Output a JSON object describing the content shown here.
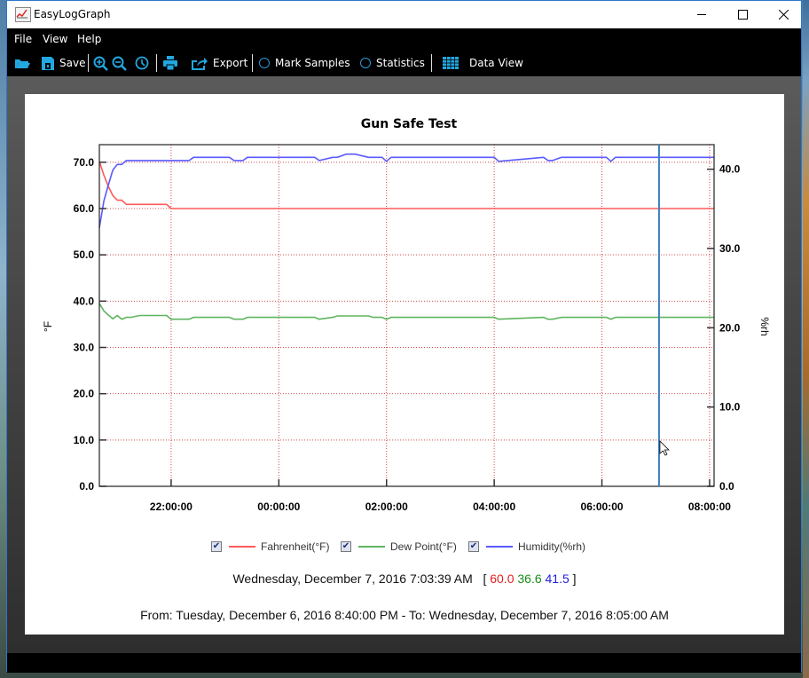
{
  "window": {
    "title": "EasyLogGraph",
    "minimize_icon": "minimize-icon",
    "maximize_icon": "maximize-icon",
    "close_icon": "close-icon"
  },
  "menu": {
    "items": [
      "File",
      "View",
      "Help"
    ]
  },
  "toolbar": {
    "open_icon": "folder-open-icon",
    "save_label": "Save",
    "zoom_in_icon": "zoom-in-icon",
    "zoom_out_icon": "zoom-out-icon",
    "clock_icon": "clock-icon",
    "print_icon": "printer-icon",
    "export_label": "Export",
    "mark_samples_label": "Mark Samples",
    "statistics_label": "Statistics",
    "data_view_label": "Data View"
  },
  "colors": {
    "fahrenheit": "#ff5a5a",
    "dew_point": "#5fb55f",
    "humidity": "#5a5aff",
    "cursor": "#3a7fbf",
    "grid": "#c81e1e",
    "accent": "#22a7e0"
  },
  "chart_data": {
    "type": "line",
    "title": "Gun Safe Test",
    "xlabel": "",
    "ylabel": "°F",
    "y2label": "%rh",
    "x_range": [
      "20:40:00",
      "08:05:00"
    ],
    "x_range_minutes": [
      0,
      685
    ],
    "xticks": [
      "22:00:00",
      "00:00:00",
      "02:00:00",
      "04:00:00",
      "06:00:00",
      "08:00:00"
    ],
    "xticks_minutes": [
      80,
      200,
      320,
      440,
      560,
      680
    ],
    "ylim": [
      0,
      73.8
    ],
    "yticks": [
      "0.0",
      "10.0",
      "20.0",
      "30.0",
      "40.0",
      "50.0",
      "60.0",
      "70.0"
    ],
    "y2lim": [
      0,
      43.1
    ],
    "y2ticks": [
      "0.0",
      "10.0",
      "20.0",
      "30.0",
      "40.0"
    ],
    "grid": true,
    "legend_placement": "bottom",
    "series": [
      {
        "name": "Fahrenheit(°F)",
        "axis": "left",
        "color": "#ff5a5a",
        "x": [
          0,
          5,
          10,
          15,
          20,
          25,
          30,
          35,
          40,
          75,
          80,
          200,
          320,
          440,
          560,
          685
        ],
        "y": [
          70.2,
          67.2,
          64.8,
          62.8,
          61.8,
          61.8,
          60.9,
          60.9,
          60.9,
          60.9,
          60.0,
          60.0,
          60.0,
          60.0,
          60.0,
          60.0
        ]
      },
      {
        "name": "Dew Point(°F)",
        "axis": "left",
        "color": "#5fb55f",
        "x": [
          0,
          5,
          10,
          15,
          20,
          25,
          30,
          35,
          45,
          75,
          80,
          100,
          105,
          145,
          150,
          160,
          165,
          200,
          240,
          245,
          260,
          265,
          300,
          305,
          315,
          320,
          325,
          440,
          445,
          495,
          500,
          505,
          515,
          565,
          570,
          575,
          585,
          685
        ],
        "y": [
          39.5,
          37.9,
          37.0,
          36.2,
          36.9,
          36.1,
          36.5,
          36.5,
          36.9,
          36.9,
          36.1,
          36.1,
          36.5,
          36.5,
          36.1,
          36.1,
          36.5,
          36.5,
          36.5,
          36.1,
          36.5,
          36.8,
          36.8,
          36.5,
          36.5,
          36.1,
          36.5,
          36.5,
          36.1,
          36.5,
          36.1,
          36.1,
          36.5,
          36.5,
          36.1,
          36.5,
          36.5,
          36.5
        ]
      },
      {
        "name": "Humidity(%rh)",
        "axis": "right",
        "color": "#5a5aff",
        "x": [
          0,
          5,
          10,
          15,
          20,
          25,
          30,
          35,
          40,
          75,
          80,
          100,
          105,
          145,
          150,
          160,
          165,
          200,
          240,
          245,
          260,
          265,
          275,
          285,
          300,
          305,
          315,
          320,
          325,
          440,
          445,
          495,
          500,
          505,
          515,
          565,
          570,
          575,
          585,
          685
        ],
        "y": [
          32.6,
          36.0,
          38.0,
          39.9,
          40.6,
          40.6,
          41.1,
          41.1,
          41.1,
          41.1,
          41.1,
          41.1,
          41.5,
          41.5,
          41.1,
          41.1,
          41.5,
          41.5,
          41.5,
          41.1,
          41.5,
          41.5,
          41.9,
          41.9,
          41.5,
          41.5,
          41.5,
          41.0,
          41.5,
          41.5,
          41.0,
          41.5,
          41.1,
          41.1,
          41.5,
          41.5,
          41.0,
          41.5,
          41.5,
          41.5
        ]
      }
    ],
    "cursor_minutes": 623.65
  },
  "legend": [
    {
      "label": "Fahrenheit(°F)",
      "checked": true
    },
    {
      "label": "Dew Point(°F)",
      "checked": true
    },
    {
      "label": "Humidity(%rh)",
      "checked": true
    }
  ],
  "cursor_readout": {
    "timestamp": "Wednesday, December 7, 2016 7:03:39 AM",
    "open_bracket": "[",
    "fahrenheit": "60.0",
    "dew_point": "36.6",
    "humidity": "41.5",
    "close_bracket": "]"
  },
  "range_text": "From: Tuesday, December 6, 2016 8:40:00 PM  -  To: Wednesday, December 7, 2016 8:05:00 AM"
}
